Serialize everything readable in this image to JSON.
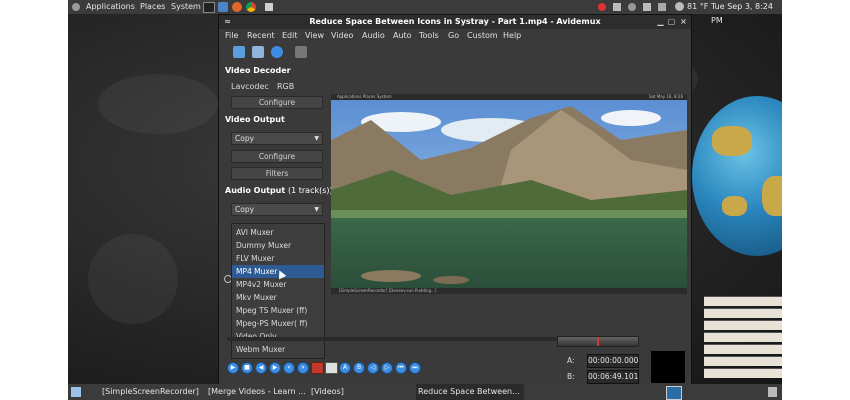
{
  "top_panel": {
    "menus": [
      "Applications",
      "Places",
      "System"
    ],
    "weather": "81 °F",
    "datetime": "Tue Sep 3, 8:24 PM"
  },
  "window": {
    "title": "Reduce Space Between Icons in Systray - Part 1.mp4 - Avidemux",
    "menu": [
      "File",
      "Recent",
      "Edit",
      "View",
      "Video",
      "Audio",
      "Auto",
      "Tools",
      "Go",
      "Custom",
      "Help"
    ]
  },
  "video_decoder": {
    "heading": "Video Decoder",
    "decoder": "Lavcodec",
    "format": "RGB",
    "configure_label": "Configure"
  },
  "video_output": {
    "heading": "Video Output",
    "selected": "Copy",
    "configure_label": "Configure",
    "filters_label": "Filters"
  },
  "audio_output": {
    "heading": "Audio Output",
    "tracks": "(1 track(s))",
    "selected": "Copy"
  },
  "muxer_dropdown": {
    "items": [
      "AVI Muxer",
      "Dummy Muxer",
      "FLV Muxer",
      "MP4 Muxer",
      "MP4v2 Muxer",
      "Mkv Muxer",
      "Mpeg TS Muxer (ff)",
      "Mpeg-PS Muxer( ff)",
      "Video Only",
      "Webm Muxer"
    ],
    "highlighted": "MP4 Muxer"
  },
  "preview": {
    "inner_menus": "Applications  Places  System",
    "inner_clock": "Sat May 18, 8:26 PM",
    "inner_tasks": "[SimpleScreenRecorder]   [Devenv.sun Pudding...]"
  },
  "time": {
    "a_label": "A:",
    "a_value": "00:00:00.000",
    "b_label": "B:",
    "b_value": "00:06:49.101"
  },
  "taskbar": {
    "items": [
      "[SimpleScreenRecorder]",
      "[Merge Videos - Learn ...",
      "[Videos]",
      "Reduce Space Between..."
    ]
  },
  "colors": {
    "selection": "#2f5b95",
    "control_blue": "#3d8ee3"
  }
}
